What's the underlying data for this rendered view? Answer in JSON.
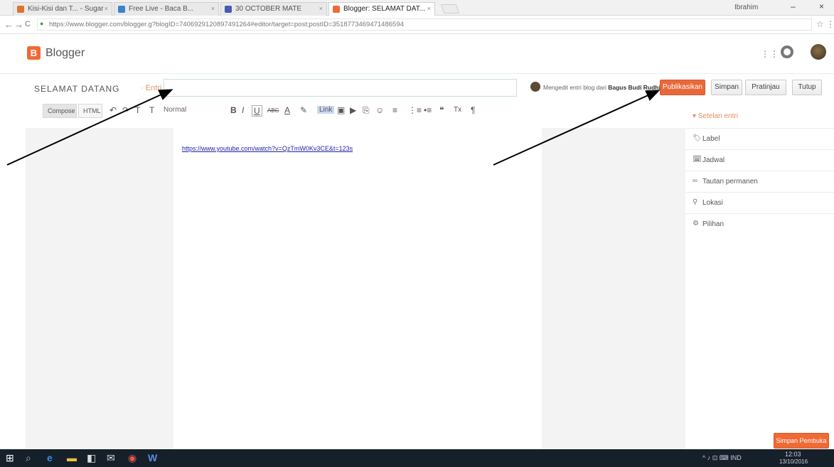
{
  "browser": {
    "tabs": [
      {
        "label": "Kisi-Kisi dan T... - Sugar",
        "icon_color": "#d9762a"
      },
      {
        "label": "Free Live - Baca B...",
        "icon_color": "#3a84c9"
      },
      {
        "label": "30 OCTOBER MATE",
        "icon_color": "#4a5ab0"
      },
      {
        "label": "Blogger: SELAMAT DAT...",
        "icon_color": "#f06a35"
      }
    ],
    "close_glyph": "×",
    "window_user": "Ibrahim",
    "minimize": "–",
    "close_window": "×",
    "back": "←",
    "forward": "→",
    "reload": "C",
    "url": "https://www.blogger.com/blogger.g?blogID=7406929120897491264#editor/target=post;postID=3518773469471486594",
    "bookmark_star": "☆",
    "menu": "⋮"
  },
  "blogger": {
    "logo_letter": "B",
    "name": "Blogger",
    "apps_glyph": "⋮⋮⋮",
    "blog_title": "SELAMAT DATANG",
    "entry_label": "· Entri",
    "post_title_value": "",
    "post_title_placeholder": "",
    "author_text": "Mengedit entri blog dari ",
    "author_name": "Bagus Budi Rudhi",
    "publish": "Publikasikan",
    "save": "Simpan",
    "preview": "Pratinjau",
    "close": "Tutup"
  },
  "toolbar": {
    "compose": "Compose",
    "html": "HTML",
    "undo": "↶",
    "redo": "↷",
    "font_size_glyph": "T",
    "font_size2_glyph": "T",
    "font_name": "Normal",
    "bold": "B",
    "italic": "I",
    "underline": "U",
    "strike": "ABC",
    "text_color": "A",
    "highlight": "✎",
    "link": "Link",
    "image": "▣",
    "video": "▶",
    "jump": "⎘",
    "emoji": "☺",
    "align": "≡",
    "num_list": "⋮≡",
    "bullet_list": "•≡",
    "quote": "❝",
    "clear": "Tx",
    "rtl": "¶"
  },
  "editor": {
    "content_link": "https://www.youtube.com/watch?v=QzTmW0Kv3CE&t=123s"
  },
  "sidebar": {
    "title": "▾ Setelan entri",
    "items": [
      {
        "icon": "🏷",
        "label": "Label"
      },
      {
        "icon": "🗓",
        "label": "Jadwal"
      },
      {
        "icon": "∞",
        "label": "Tautan permanen"
      },
      {
        "icon": "⚲",
        "label": "Lokasi"
      },
      {
        "icon": "⚙",
        "label": "Pilihan"
      }
    ],
    "bottom_save": "Simpan Pembuka"
  },
  "taskbar": {
    "start": "⊞",
    "search": "⌕",
    "apps": [
      {
        "glyph": "e",
        "color": "#3a8de0"
      },
      {
        "glyph": "▬",
        "color": "#e8c33a"
      },
      {
        "glyph": "◧",
        "color": "#ddd"
      },
      {
        "glyph": "✉",
        "color": "#ddd"
      },
      {
        "glyph": "◉",
        "color": "#e25a48"
      },
      {
        "glyph": "W",
        "color": "#5a8ae0"
      }
    ],
    "tray": "^ ♪ ⊡ ⌨ IND",
    "time": "12:03",
    "date": "13/10/2016"
  },
  "colors": {
    "accent": "#f06a35",
    "publish_bg": "#e9683a",
    "link": "#2222aa",
    "taskbar": "#16202a"
  }
}
